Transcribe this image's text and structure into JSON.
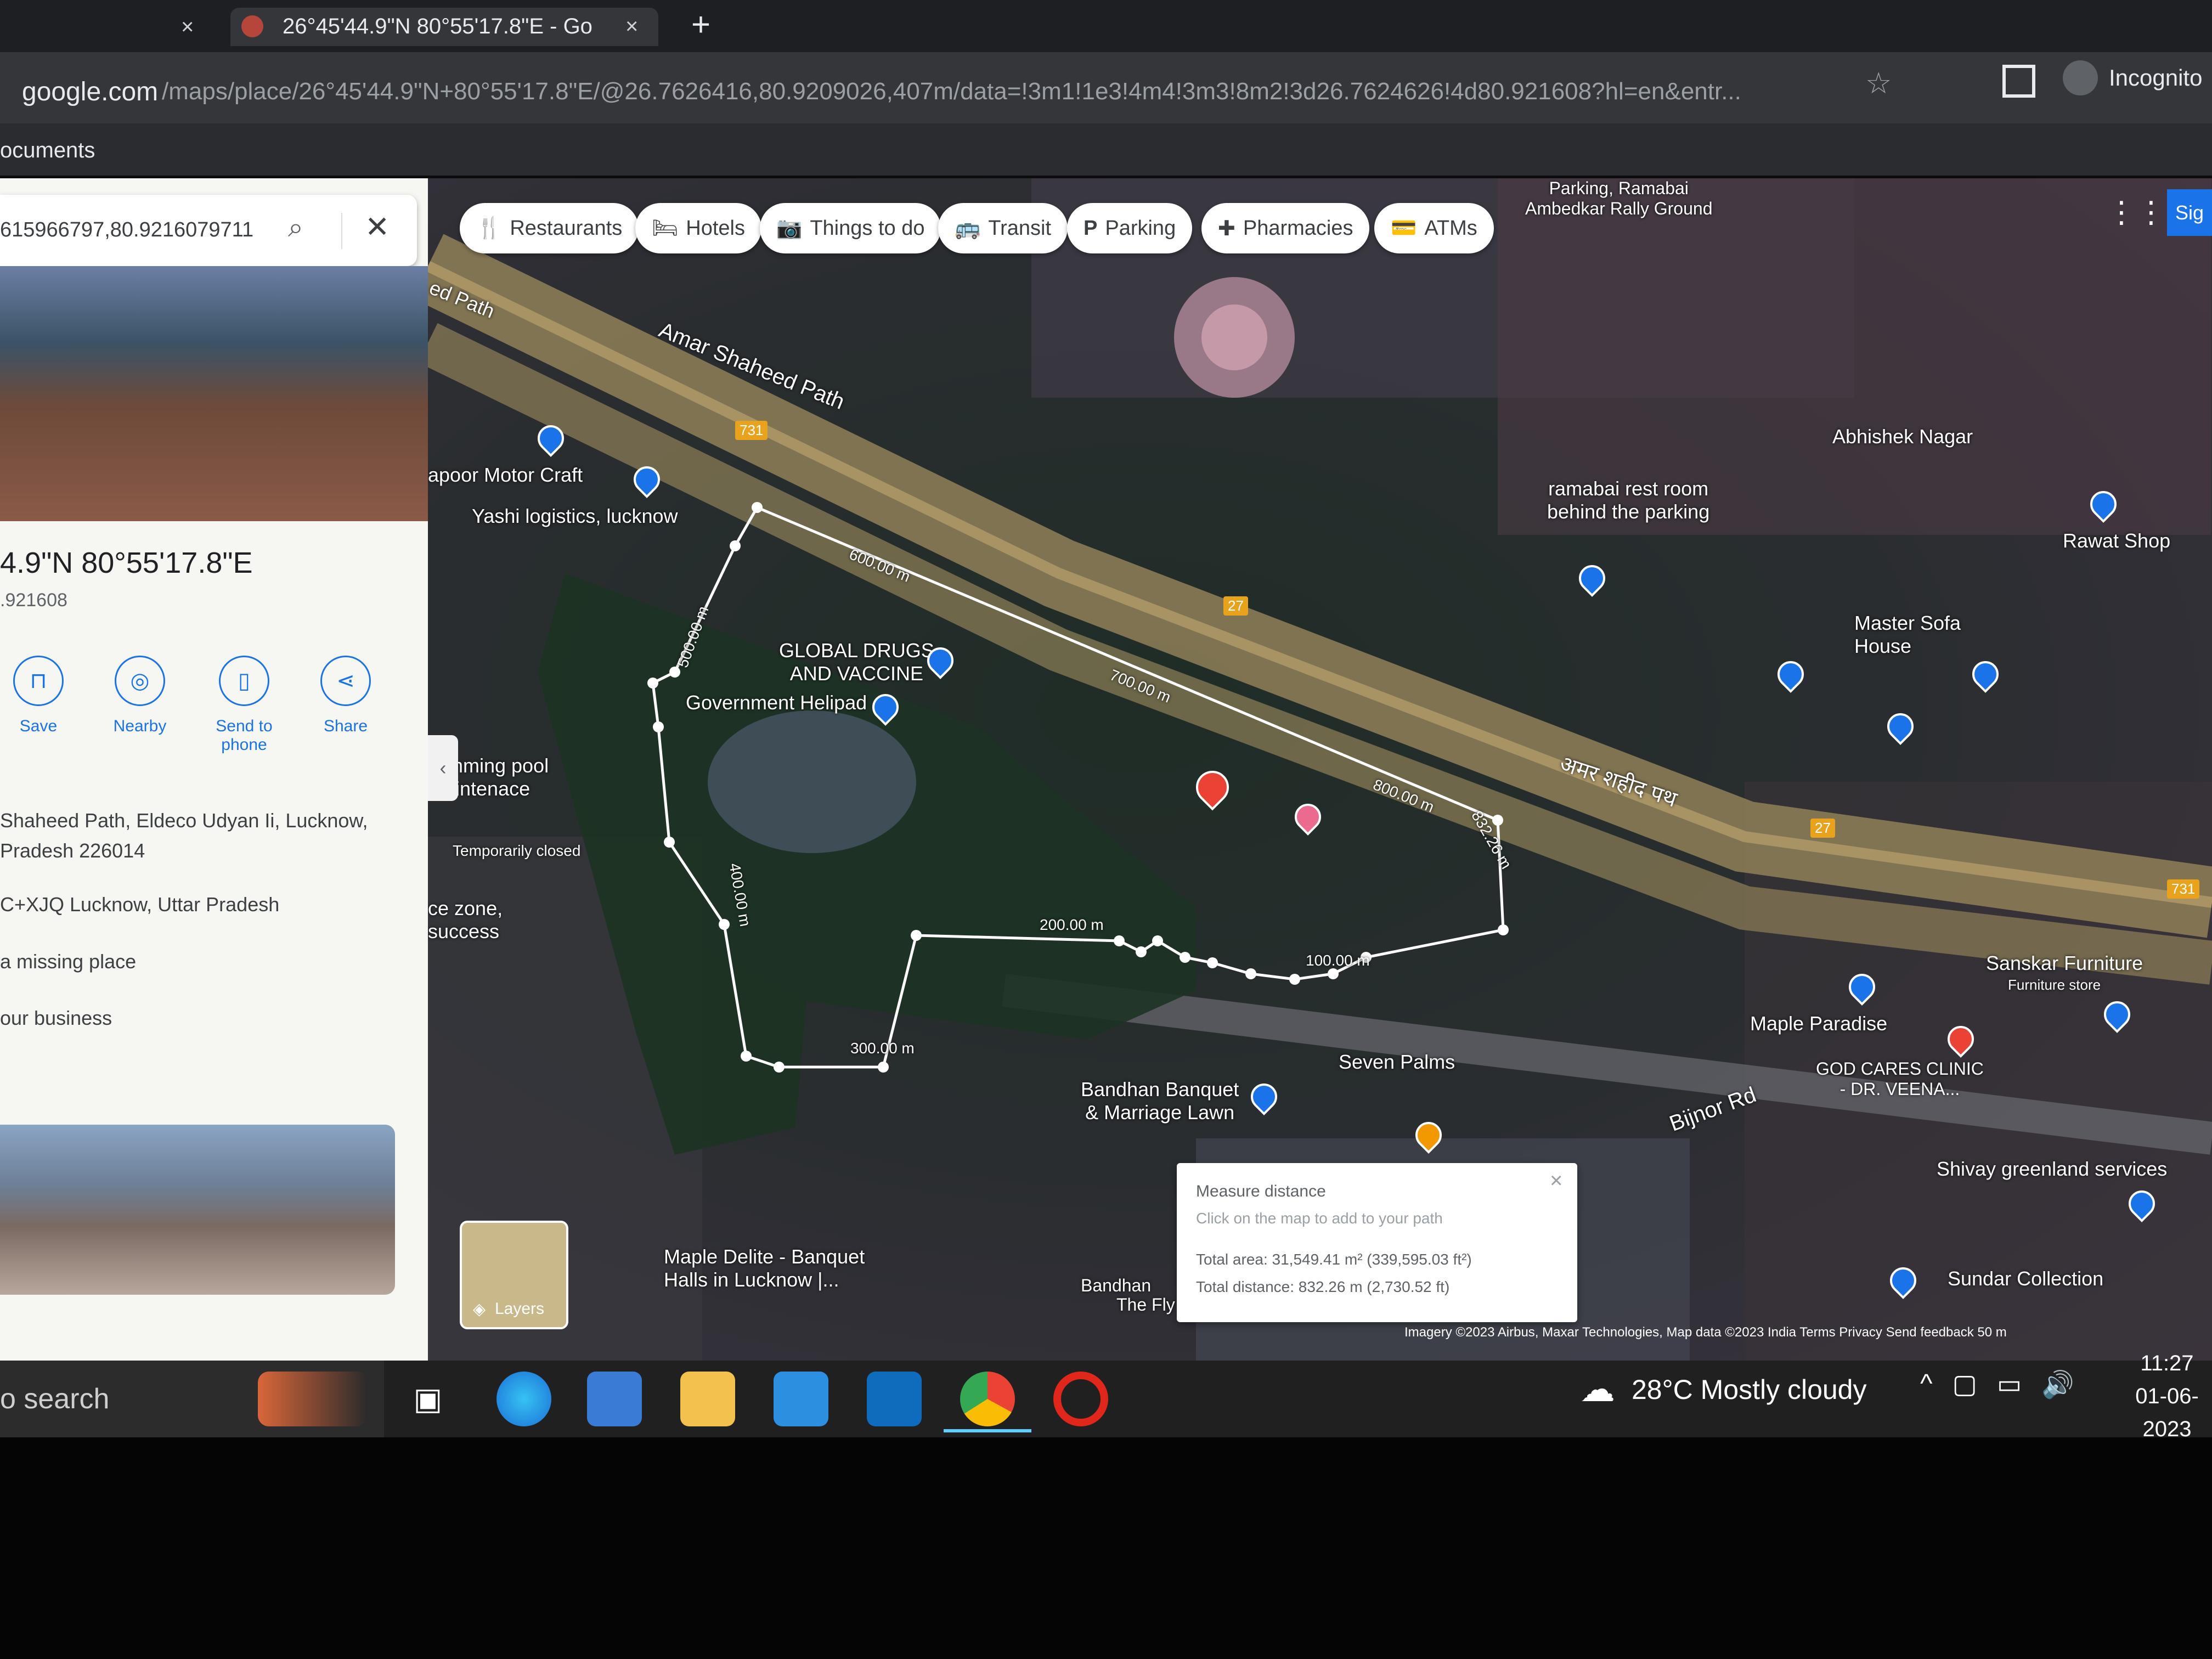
{
  "browser": {
    "tabs": [
      {
        "title": "",
        "close": "×",
        "active": false
      },
      {
        "title": "26°45'44.9\"N 80°55'17.8\"E - Go",
        "close": "×",
        "active": true
      }
    ],
    "new_tab": "+",
    "url_host": "google.com",
    "url_path": "/maps/place/26°45'44.9\"N+80°55'17.8\"E/@26.7626416,80.9209026,407m/data=!3m1!1e3!4m4!3m3!8m2!3d26.7624626!4d80.921608?hl=en&entr...",
    "profile_label": "Incognito",
    "bookmark": "ocuments"
  },
  "side_panel": {
    "search_value": "615966797,80.9216079711",
    "title": "4.9\"N 80°55'17.8\"E",
    "subtitle": ".921608",
    "actions": [
      {
        "label": "Save",
        "icon": "bookmark-icon"
      },
      {
        "label": "Nearby",
        "icon": "nearby-icon"
      },
      {
        "label": "Send to phone",
        "icon": "send-to-phone-icon"
      },
      {
        "label": "Share",
        "icon": "share-icon"
      }
    ],
    "address_line1": " Shaheed Path, Eldeco Udyan Ii, Lucknow,",
    "address_line2": " Pradesh 226014",
    "plus_code": "C+XJQ Lucknow, Uttar Pradesh",
    "add_missing": "a missing place",
    "add_business": "our business"
  },
  "map": {
    "chips": [
      "Restaurants",
      "Hotels",
      "Things to do",
      "Transit",
      "Parking",
      "Pharmacies",
      "ATMs"
    ],
    "labels": {
      "parking_ground": "Parking, Ramabai\nAmbedkar Rally Ground",
      "amar_shaheed_path": "Amar Shaheed Path",
      "shield_731": "731",
      "shield_27": "27",
      "red_path": "ed Path",
      "apoor_motor": "apoor Motor Craft",
      "yashi_logistics": "Yashi logistics, lucknow",
      "global_drugs": "GLOBAL DRUGS\nAND VACCINE",
      "government_helipad": "Government Helipad",
      "swimming_pool": "wimming pool\nmaintenace",
      "temporarily_closed": "Temporarily closed",
      "ce_zone": "ce zone,\nsuccess",
      "ramabai_rest": "ramabai rest room\nbehind the parking",
      "abhishek_nagar": "Abhishek Nagar",
      "rawat_shop": "Rawat Shop",
      "master_sofa": "Master Sofa\nHouse",
      "hindi_path": "अमर शहीद पथ",
      "sanskar": "Sanskar Furniture",
      "furniture_store": "Furniture store",
      "maple_paradise": "Maple Paradise",
      "god_cares": "GOD CARES CLINIC\n- DR. VEENA...",
      "bijnor_rd": "Bijnor Rd",
      "seven_palms": "Seven Palms",
      "bandhan_banquet": "Bandhan Banquet\n& Marriage Lawn",
      "bandhan_short": "Bandhan",
      "shivay": "Shivay greenland services",
      "sundar": "Sundar Collection",
      "maple_delite": "Maple Delite - Banquet\nHalls in Lucknow |...",
      "the_fly": "The Fly"
    },
    "measure_labels": [
      "600.00 m",
      "500.00 m",
      "700.00 m",
      "800.00 m",
      "832.26 m",
      "400.00 m",
      "200.00 m",
      "100.00 m",
      "300.00 m"
    ],
    "layers_label": "Layers",
    "measure": {
      "title": "Measure distance",
      "hint": "Click on the map to add to your path",
      "total_area": "Total area: 31,549.41 m² (339,595.03 ft²)",
      "total_distance": "Total distance: 832.26 m (2,730.52 ft)",
      "close": "×"
    },
    "attribution": "Imagery ©2023 Airbus, Maxar Technologies, Map data ©2023   India   Terms   Privacy   Send feedback   50 m",
    "sign_in": "Sig"
  },
  "taskbar": {
    "search_text": "o search",
    "weather": "28°C  Mostly cloudy",
    "time": "11:27",
    "date": "01-06-2023"
  }
}
